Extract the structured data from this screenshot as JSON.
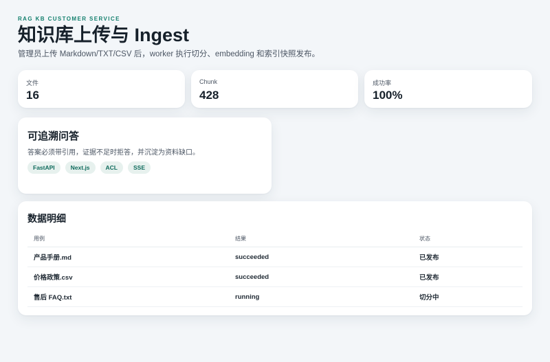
{
  "header": {
    "eyebrow": "RAG KB CUSTOMER SERVICE",
    "title": "知识库上传与 Ingest",
    "subtitle": "管理员上传 Markdown/TXT/CSV 后，worker 执行切分、embedding 和索引快照发布。"
  },
  "stats": [
    {
      "label": "文件",
      "value": "16"
    },
    {
      "label": "Chunk",
      "value": "428"
    },
    {
      "label": "成功率",
      "value": "100%"
    }
  ],
  "feature": {
    "title": "可追溯问答",
    "description": "答案必须带引用，证据不足时拒答，并沉淀为资料缺口。",
    "tags": [
      "FastAPI",
      "Next.js",
      "ACL",
      "SSE"
    ]
  },
  "table": {
    "title": "数据明细",
    "columns": [
      "用例",
      "结果",
      "状态"
    ],
    "rows": [
      [
        "产品手册.md",
        "succeeded",
        "已发布"
      ],
      [
        "价格政策.csv",
        "succeeded",
        "已发布"
      ],
      [
        "售后 FAQ.txt",
        "running",
        "切分中"
      ]
    ]
  }
}
